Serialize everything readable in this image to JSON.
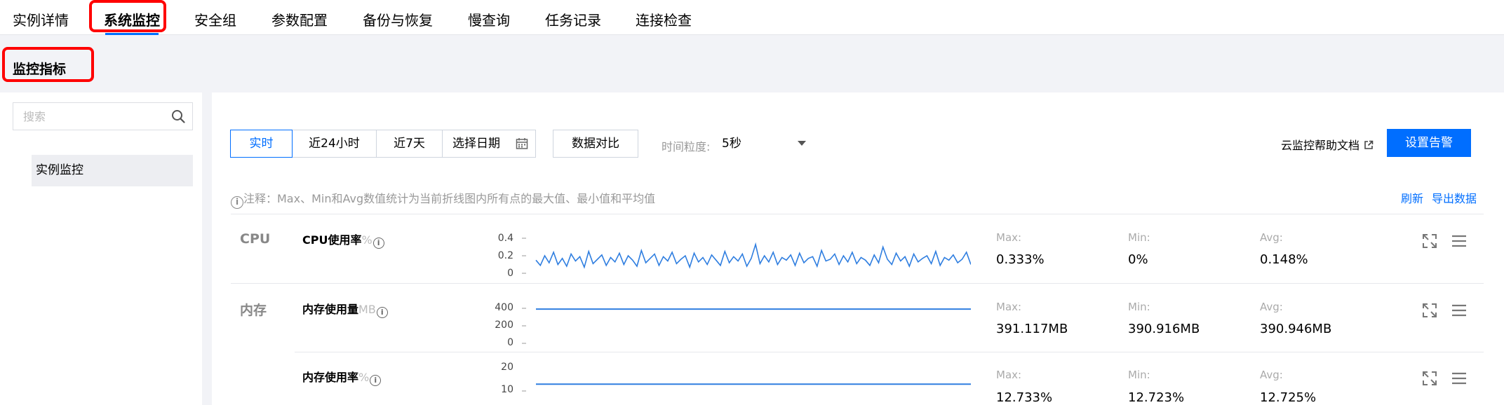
{
  "tabs": [
    {
      "label": "实例详情"
    },
    {
      "label": "系统监控",
      "active": true
    },
    {
      "label": "安全组"
    },
    {
      "label": "参数配置"
    },
    {
      "label": "备份与恢复"
    },
    {
      "label": "慢查询"
    },
    {
      "label": "任务记录"
    },
    {
      "label": "连接检查"
    }
  ],
  "section_title": "监控指标",
  "sidebar": {
    "search_placeholder": "搜索",
    "items": [
      {
        "label": "实例监控"
      }
    ]
  },
  "toolbar": {
    "ranges": [
      "实时",
      "近24小时",
      "近7天"
    ],
    "active_range": "实时",
    "date_picker_label": "选择日期",
    "compare_label": "数据对比",
    "granularity_label": "时间粒度:",
    "granularity_value": "5秒",
    "help_link": "云监控帮助文档",
    "alarm_button": "设置告警"
  },
  "note": "注释：Max、Min和Avg数值统计为当前折线图内所有点的最大值、最小值和平均值",
  "actions": {
    "refresh": "刷新",
    "export": "导出数据"
  },
  "stat_labels": {
    "max": "Max:",
    "min": "Min:",
    "avg": "Avg:"
  },
  "metrics": [
    {
      "category": "CPU",
      "name": "CPU使用率",
      "unit": "%",
      "y_ticks": [
        "0.4",
        "0.2",
        "0"
      ],
      "max": "0.333%",
      "min": "0%",
      "avg": "0.148%"
    },
    {
      "category": "内存",
      "name": "内存使用量",
      "unit": "MB",
      "y_ticks": [
        "400",
        "200",
        "0"
      ],
      "max": "391.117MB",
      "min": "390.916MB",
      "avg": "390.946MB"
    },
    {
      "category": "",
      "name": "内存使用率",
      "unit": "%",
      "y_ticks": [
        "20",
        "10"
      ],
      "max": "12.733%",
      "min": "12.723%",
      "avg": "12.725%"
    }
  ],
  "chart_data": [
    {
      "type": "line",
      "title": "CPU使用率",
      "ylim": [
        0,
        0.4
      ],
      "series": [
        {
          "values": [
            0.15,
            0.09,
            0.2,
            0.12,
            0.24,
            0.1,
            0.17,
            0.08,
            0.22,
            0.14,
            0.19,
            0.07,
            0.25,
            0.11,
            0.16,
            0.21,
            0.09,
            0.18,
            0.13,
            0.23,
            0.1,
            0.2,
            0.15,
            0.08,
            0.26,
            0.12,
            0.17,
            0.22,
            0.09,
            0.19,
            0.14,
            0.24,
            0.11,
            0.16,
            0.2,
            0.07,
            0.23,
            0.13,
            0.18,
            0.1,
            0.21,
            0.15,
            0.09,
            0.25,
            0.12,
            0.19,
            0.14,
            0.22,
            0.08,
            0.17,
            0.33,
            0.11,
            0.2,
            0.13,
            0.24,
            0.1,
            0.18,
            0.15,
            0.21,
            0.09,
            0.23,
            0.12,
            0.17,
            0.19,
            0.08,
            0.26,
            0.14,
            0.16,
            0.22,
            0.1,
            0.2,
            0.13,
            0.24,
            0.11,
            0.18,
            0.15,
            0.09,
            0.21,
            0.12,
            0.3,
            0.16,
            0.1,
            0.23,
            0.14,
            0.19,
            0.08,
            0.22,
            0.13,
            0.17,
            0.2,
            0.11,
            0.25,
            0.09,
            0.18,
            0.15,
            0.21,
            0.12,
            0.16,
            0.24,
            0.1
          ]
        }
      ]
    },
    {
      "type": "line",
      "title": "内存使用量",
      "ylim": [
        0,
        400
      ],
      "series": [
        {
          "values": [
            390.95,
            390.94,
            390.95,
            391.0,
            390.93,
            390.95,
            391.12,
            390.94,
            390.92,
            390.95
          ]
        }
      ]
    },
    {
      "type": "line",
      "title": "内存使用率",
      "ylim": [
        0,
        20
      ],
      "series": [
        {
          "values": [
            12.725,
            12.724,
            12.726,
            12.733,
            12.725,
            12.723,
            12.725,
            12.726,
            12.724,
            12.725
          ]
        }
      ]
    }
  ],
  "colors": {
    "accent": "#006eff",
    "line": "#2f7ee0",
    "highlight": "#ff0000"
  }
}
